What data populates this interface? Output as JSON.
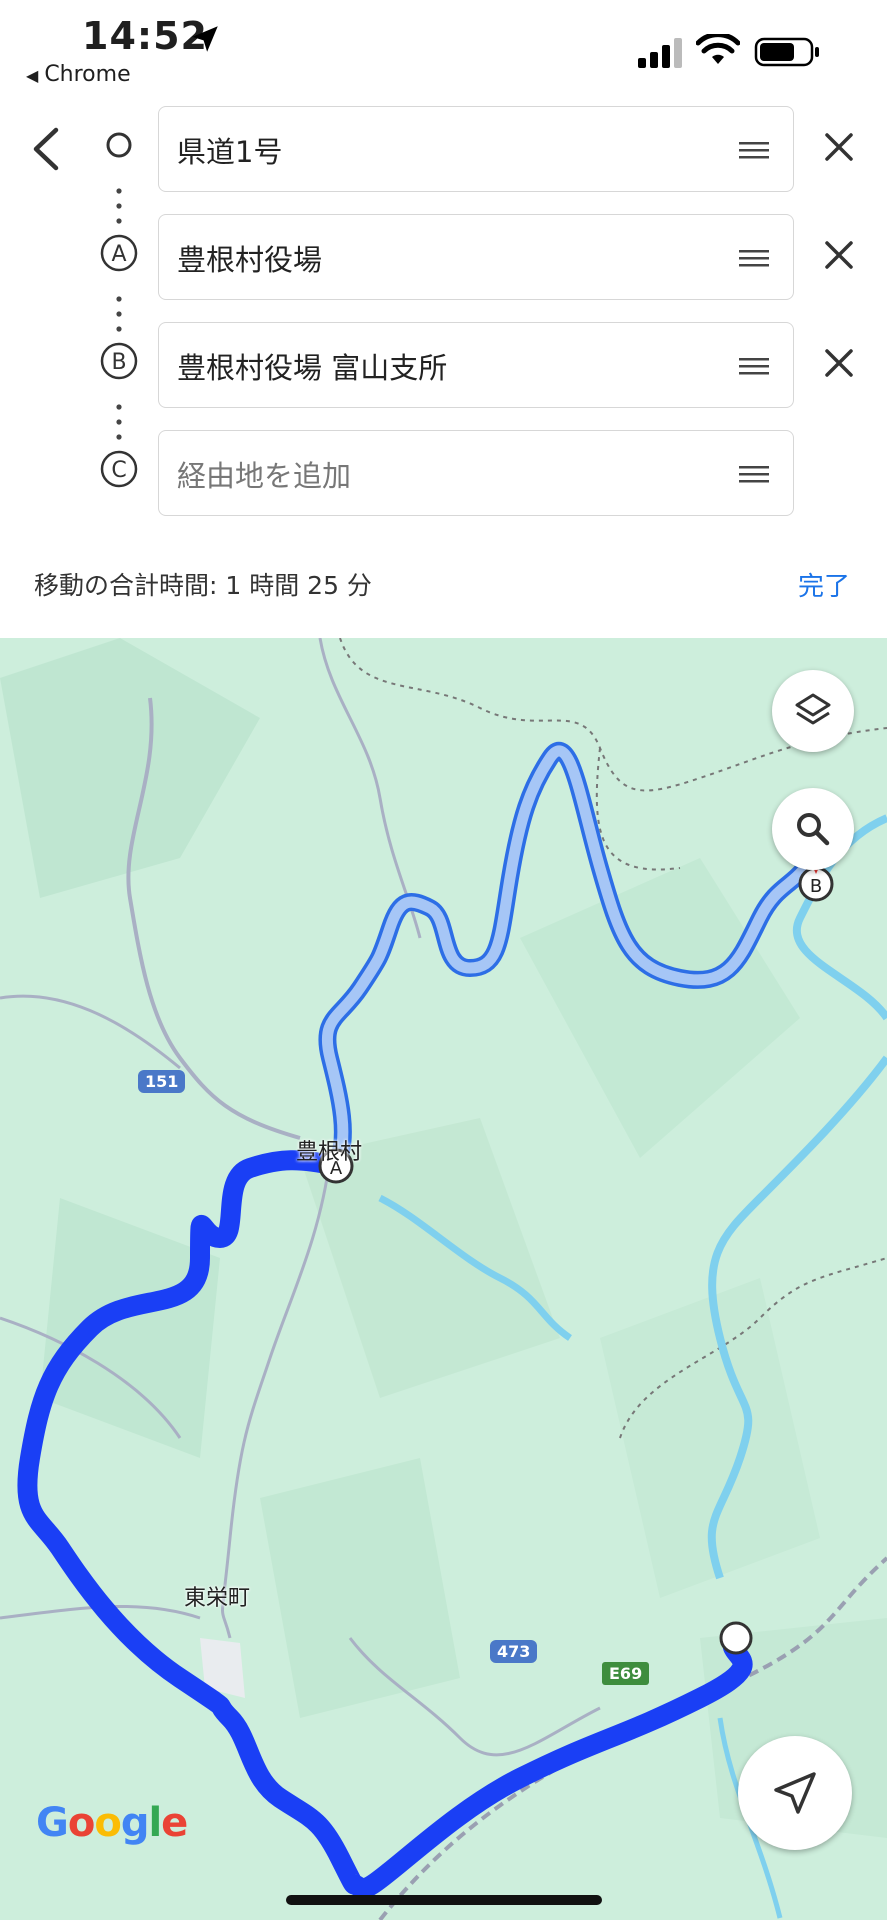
{
  "status": {
    "time": "14:52",
    "back_app": "Chrome"
  },
  "directions": {
    "rows": [
      {
        "marker": "○",
        "value": "県道1号",
        "placeholder": ""
      },
      {
        "marker": "A",
        "value": "豊根村役場",
        "placeholder": ""
      },
      {
        "marker": "B",
        "value": "豊根村役場 富山支所",
        "placeholder": ""
      },
      {
        "marker": "C",
        "value": "",
        "placeholder": "経由地を追加"
      }
    ],
    "total_label": "移動の合計時間: 1 時間 25 分",
    "done_label": "完了"
  },
  "map": {
    "labels": {
      "village": "豊根村",
      "town": "東栄町"
    },
    "shields": {
      "r151": "151",
      "r473": "473",
      "e69": "E69"
    },
    "google_logo": "Google",
    "route_color": "#1a3ff5",
    "alt_route_color": "#9bbcf5"
  }
}
